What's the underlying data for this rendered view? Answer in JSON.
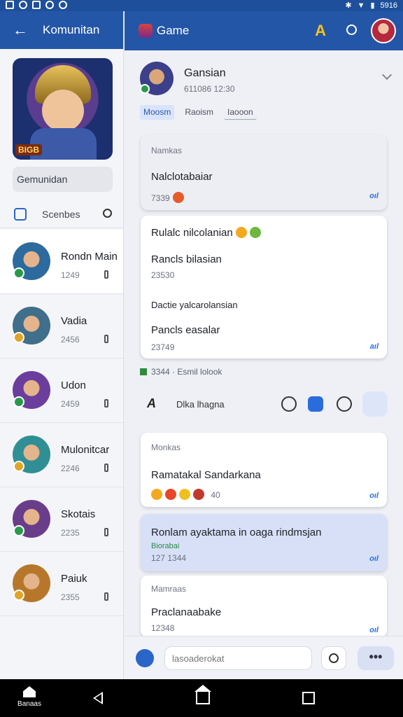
{
  "status": {
    "time": "5916"
  },
  "left": {
    "header": {
      "title": "Komunitan"
    },
    "game_tag": "BIGB",
    "community_label": "Gemunidan",
    "search_label": "Scenbes",
    "items": [
      {
        "name": "Rondn Main",
        "count": "1249",
        "color": "#2d6a9e",
        "badge": "#2a9a4a"
      },
      {
        "name": "Vadia",
        "count": "2456",
        "color": "#3f6f8a",
        "badge": "#e0a526"
      },
      {
        "name": "Udon",
        "count": "2459",
        "color": "#6b3e9e",
        "badge": "#2a9a4a"
      },
      {
        "name": "Mulonitcar",
        "count": "2246",
        "color": "#2f8f95",
        "badge": "#e0a526"
      },
      {
        "name": "Skotais",
        "count": "2235",
        "color": "#6a3d8a",
        "badge": "#2a9a4a"
      },
      {
        "name": "Paiuk",
        "count": "2355",
        "color": "#b7772a",
        "badge": "#e0a526"
      }
    ]
  },
  "right": {
    "header": {
      "title": "Game",
      "a_logo": "A"
    },
    "post": {
      "author": "Gansian",
      "date": "611086  12:30",
      "chips": [
        "Moosm",
        "Raoism",
        "Iaooon"
      ]
    },
    "cards": [
      {
        "section": "Namkas",
        "text": "Nalclotabaiar",
        "meta": "7339",
        "signal": "oıl"
      },
      {
        "lines": [
          "Rulalc nilcolanian",
          "Rancls bilasian"
        ],
        "meta1": "23530",
        "lines2": [
          "Dactie yalcarolansian",
          "Pancls easalar"
        ],
        "meta2": "23749",
        "signal": "aıl"
      },
      {
        "section": "Monkas",
        "text": "Ramatakal Sandarkana",
        "meta": "40",
        "signal": "oıl"
      },
      {
        "text": "Ronlam ayaktama in oaga rindmsjan",
        "tag": "Biorabai",
        "meta": "127  1344",
        "signal": "oıl"
      },
      {
        "section": "Mamraas",
        "text": "Praclanaabake",
        "meta": "12348",
        "signal": "oıl"
      }
    ],
    "divider_text": "3344  · Esmil lolook",
    "action_bar": {
      "logo": "A",
      "label": "Dlka lhagna"
    },
    "composer": {
      "placeholder": "lasoaderokat",
      "more": "•••"
    }
  },
  "nav": {
    "home_label": "Banaas"
  }
}
